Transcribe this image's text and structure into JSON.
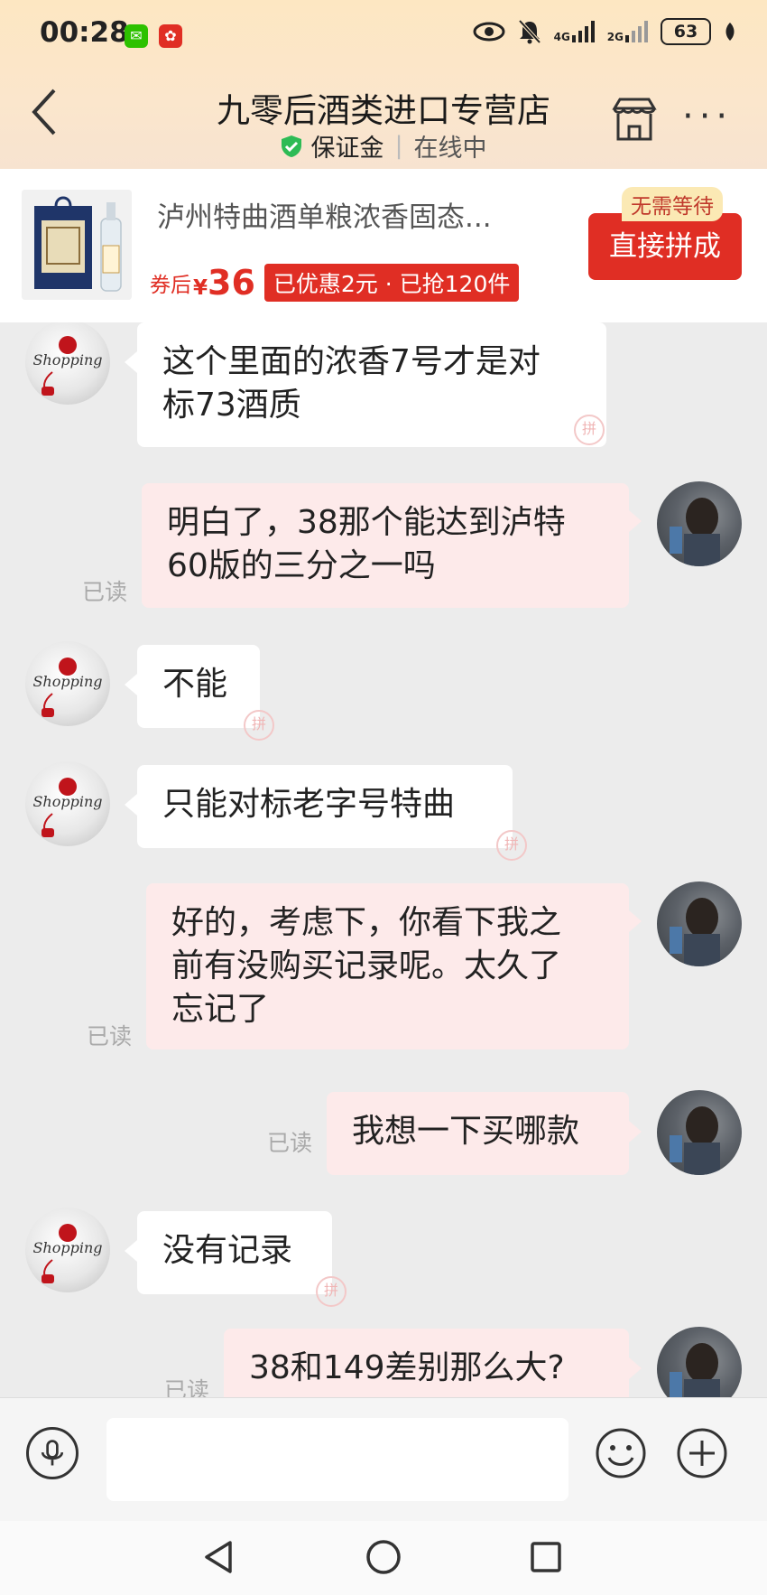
{
  "status_bar": {
    "time": "00:28",
    "network_1": "4G",
    "network_2": "2G",
    "battery": "63",
    "app_icons": [
      "wechat-icon",
      "message-app-icon"
    ],
    "right_icons": [
      "eye-icon",
      "mute-bell-icon",
      "signal-icon",
      "leaf-icon"
    ]
  },
  "header": {
    "shop_name": "九零后酒类进口专营店",
    "badge": "保证金",
    "status": "在线中",
    "icons": [
      "back-icon",
      "store-icon",
      "more-icon"
    ]
  },
  "product": {
    "name": "泸州特曲酒单粮浓香固态...",
    "coupon_prefix": "券后",
    "currency": "¥",
    "price": "36",
    "discount_info": "已优惠2元 · 已抢120件",
    "no_wait_badge": "无需等待",
    "join_button": "直接拼成"
  },
  "messages": [
    {
      "from": "shop",
      "text": "这个里面的浓香7号才是对标73酒质",
      "line1": "这个里面的浓香7号才是对",
      "line2": "标73酒质"
    },
    {
      "from": "user",
      "line1": "明白了，38那个能达到泸特",
      "line2": "60版的三分之一吗",
      "read": "已读"
    },
    {
      "from": "shop",
      "line1": "不能"
    },
    {
      "from": "shop",
      "line1": "只能对标老字号特曲"
    },
    {
      "from": "user",
      "line1": "好的，考虑下，你看下我之",
      "line2": "前有没购买记录呢。太久了",
      "line3": "忘记了",
      "read": "已读"
    },
    {
      "from": "user",
      "line1": "我想一下买哪款",
      "read": "已读"
    },
    {
      "from": "shop",
      "line1": "没有记录"
    },
    {
      "from": "user",
      "line1": "38和149差别那么大?",
      "read": "已读"
    }
  ],
  "input": {
    "placeholder": ""
  },
  "bottom_icons": [
    "voice-icon",
    "emoji-icon",
    "plus-icon"
  ],
  "system_nav": [
    "back-triangle-icon",
    "home-circle-icon",
    "recent-square-icon"
  ]
}
